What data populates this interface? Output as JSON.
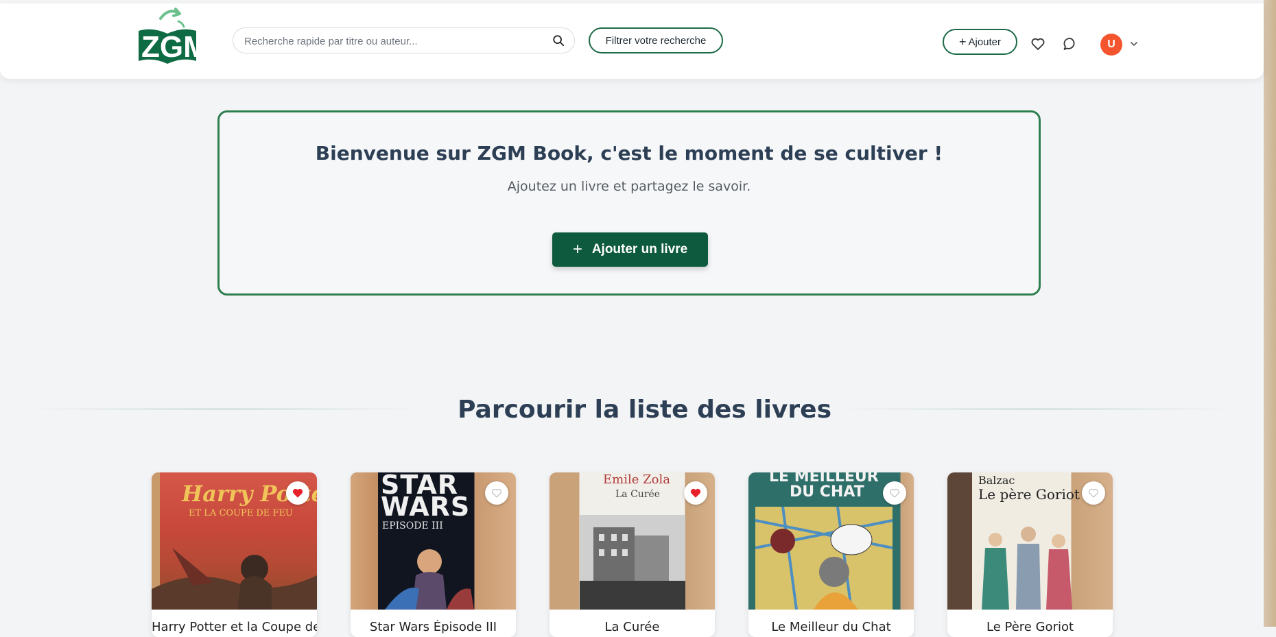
{
  "header": {
    "logo_text": "ZGM",
    "search": {
      "placeholder": "Recherche rapide par titre ou auteur..."
    },
    "filter_label": "Filtrer votre recherche",
    "add_label": "Ajouter",
    "user_initial": "U"
  },
  "welcome": {
    "title": "Bienvenue sur ZGM Book, c'est le moment de se cultiver !",
    "subtitle": "Ajoutez un livre et partagez le savoir.",
    "button_label": "Ajouter un livre"
  },
  "section": {
    "title": "Parcourir la liste des livres",
    "icon": "books-icon"
  },
  "books": [
    {
      "title": "Harry Potter et la Coupe de Feu",
      "favorite": true,
      "cover_line1": "Harry Potter",
      "cover_line2": "ET LA COUPE DE FEU"
    },
    {
      "title": "Star Wars Épisode III",
      "favorite": false,
      "cover_line1": "STAR",
      "cover_line2": "WARS",
      "cover_line3": "EPISODE III"
    },
    {
      "title": "La Curée",
      "favorite": true,
      "cover_line1": "Emile Zola",
      "cover_line2": "La Curée"
    },
    {
      "title": "Le Meilleur du Chat",
      "favorite": false,
      "cover_line1": "LE MEILLEUR",
      "cover_line2": "DU CHAT"
    },
    {
      "title": "Le Père Goriot",
      "favorite": false,
      "cover_line1": "Balzac",
      "cover_line2": "Le père Goriot"
    }
  ],
  "colors": {
    "brand_green": "#0e5a3e",
    "favorite_red": "#e8202a",
    "avatar": "#f4552f"
  }
}
